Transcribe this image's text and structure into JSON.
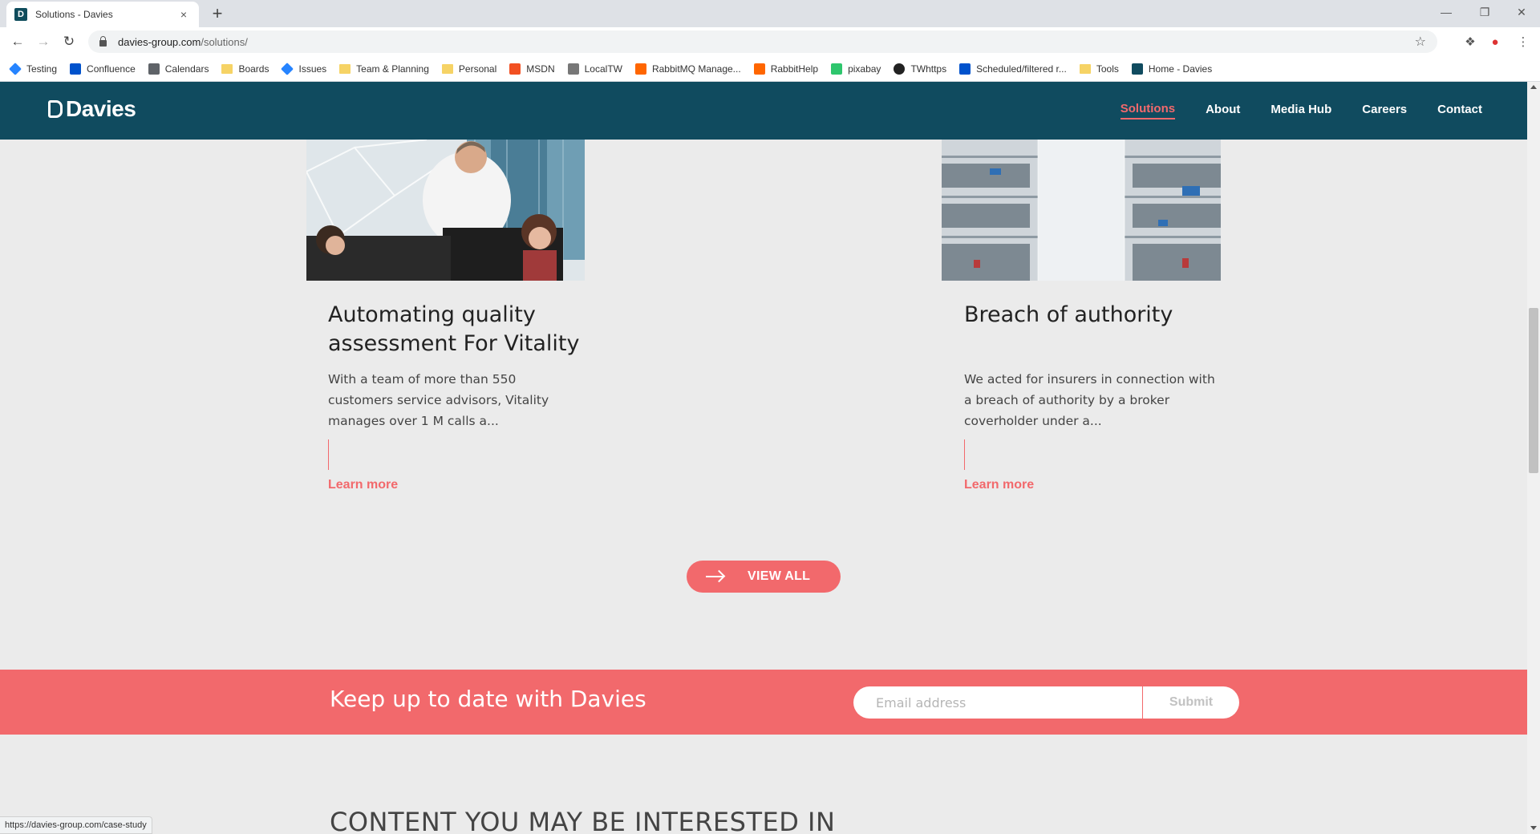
{
  "browser": {
    "tab_title": "Solutions - Davies",
    "tab_close": "×",
    "new_tab": "+",
    "url_domain": "davies-group.com",
    "url_path": "/solutions/",
    "bookmarks": [
      {
        "label": "Testing",
        "icon": "diamond-icon",
        "color": "#2684ff"
      },
      {
        "label": "Confluence",
        "icon": "confluence-icon",
        "color": "#0052cc"
      },
      {
        "label": "Calendars",
        "icon": "calendar-icon",
        "color": "#5f6368"
      },
      {
        "label": "Boards",
        "icon": "folder-icon",
        "color": "#f6d365"
      },
      {
        "label": "Issues",
        "icon": "diamond-icon",
        "color": "#2684ff"
      },
      {
        "label": "Team & Planning",
        "icon": "folder-icon",
        "color": "#f6d365"
      },
      {
        "label": "Personal",
        "icon": "folder-icon",
        "color": "#f6d365"
      },
      {
        "label": "MSDN",
        "icon": "microsoft-icon",
        "color": "#f25022"
      },
      {
        "label": "LocalTW",
        "icon": "page-icon",
        "color": "#777777"
      },
      {
        "label": "RabbitMQ Manage...",
        "icon": "rabbitmq-icon",
        "color": "#ff6600"
      },
      {
        "label": "RabbitHelp",
        "icon": "rabbitmq-icon",
        "color": "#ff6600"
      },
      {
        "label": "pixabay",
        "icon": "pixabay-icon",
        "color": "#2ec66d"
      },
      {
        "label": "TWhttps",
        "icon": "circle-icon",
        "color": "#222222"
      },
      {
        "label": "Scheduled/filtered r...",
        "icon": "confluence-icon",
        "color": "#0052cc"
      },
      {
        "label": "Tools",
        "icon": "folder-icon",
        "color": "#f6d365"
      },
      {
        "label": "Home - Davies",
        "icon": "davies-icon",
        "color": "#104b5f"
      }
    ],
    "status_url": "https://davies-group.com/case-study"
  },
  "site": {
    "logo_text": "Davies",
    "nav": [
      "Solutions",
      "About",
      "Media Hub",
      "Careers",
      "Contact"
    ],
    "active_nav": "Solutions",
    "brand_color": "#104b5f",
    "accent_color": "#f2696c"
  },
  "cards": [
    {
      "title_line1": "Automating quality",
      "title_line2": "assessment For Vitality",
      "text_line1": "With a team of more than 550",
      "text_line2": "customers service advisors, Vitality",
      "text_line3": "manages over 1 M calls a...",
      "link": "Learn more"
    },
    {
      "title_line1": "Breach of authority",
      "title_line2": "",
      "text_line1": "We acted for insurers in connection with",
      "text_line2": "a breach of authority by a broker",
      "text_line3": "coverholder under a...",
      "link": "Learn more"
    }
  ],
  "view_all": "VIEW ALL",
  "newsletter": {
    "heading": "Keep up to date with Davies",
    "email_placeholder": "Email address",
    "submit": "Submit"
  },
  "section_heading": "CONTENT YOU MAY BE INTERESTED IN"
}
